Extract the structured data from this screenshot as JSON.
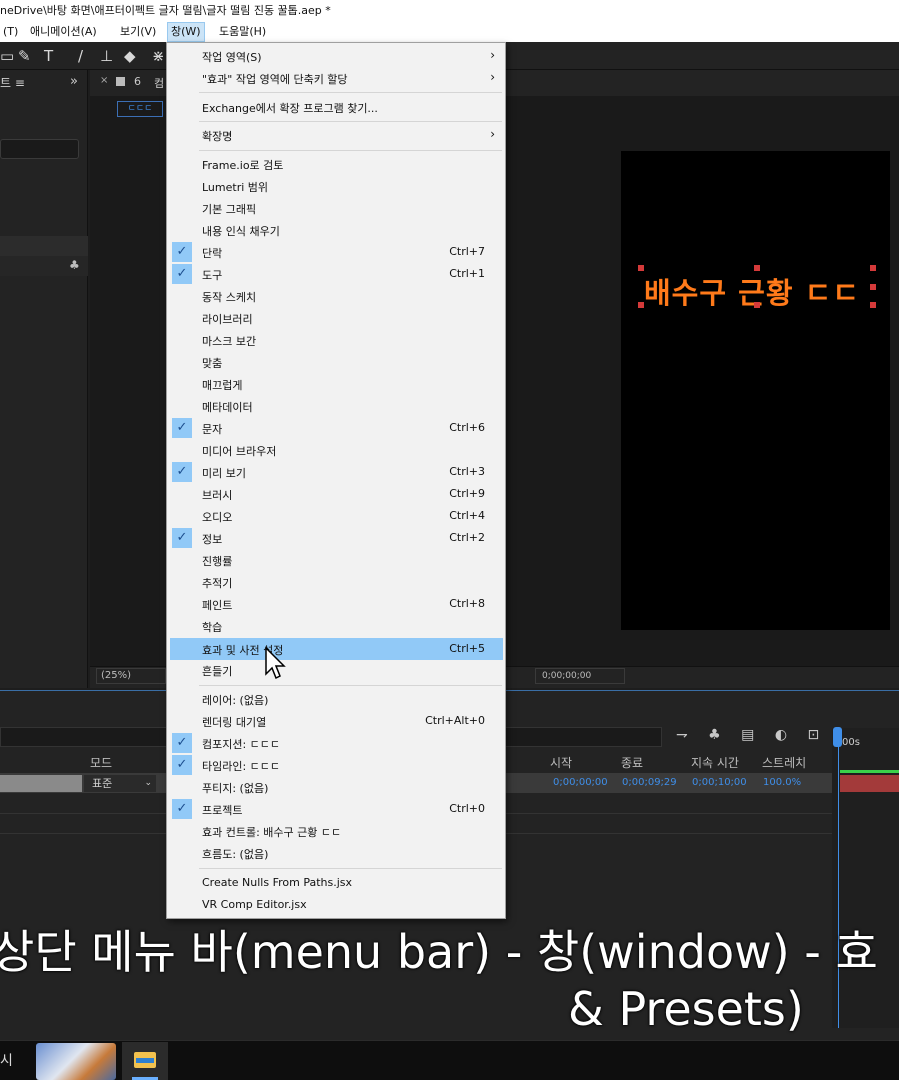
{
  "titlebar": {
    "text": "neDrive\\바탕 화면\\애프터이펙트 글자 떨림\\글자 떨림 진동 꿀톱.aep *"
  },
  "menubar": {
    "items": [
      "(T)",
      "애니메이션(A)",
      "보기(V)",
      "창(W)",
      "도움말(H)"
    ]
  },
  "left_panel": {
    "tab_label": "트 ≡",
    "expand_label": "»"
  },
  "comp_panel": {
    "tab_label": "컴",
    "subtab_label": "ㄷㄷㄷ",
    "zoom": "(25%)",
    "timecode": "0;00;00;00"
  },
  "canvas_text": "배수구 근황 ㄷㄷ",
  "timeline": {
    "columns": {
      "mode": "모드",
      "start": "시작",
      "end": "종료",
      "duration": "지속 시간",
      "stretch": "스트레치"
    },
    "row": {
      "mode_value": "표준",
      "start": "0;00;00;00",
      "end": "0;00;09;29",
      "duration": "0;00;10;00",
      "stretch": "100.0%"
    },
    "ruler_label": "00s"
  },
  "subtitle": {
    "line1": "상단 메뉴 바(menu bar) - 창(window) - 효",
    "line2": "& Presets)"
  },
  "taskbar": {
    "text": "시"
  },
  "window_menu": {
    "items": [
      {
        "label": "작업 영역(S)",
        "shortcut": "",
        "checked": false,
        "submenu": true
      },
      {
        "label": "\"효과\" 작업 영역에 단축키 할당",
        "shortcut": "",
        "checked": false,
        "submenu": true
      },
      {
        "label": "Exchange에서 확장 프로그램 찾기...",
        "shortcut": "",
        "checked": false,
        "submenu": false
      },
      {
        "label": "확장명",
        "shortcut": "",
        "checked": false,
        "submenu": true
      },
      {
        "label": "Frame.io로 검토",
        "shortcut": "",
        "checked": false,
        "submenu": false
      },
      {
        "label": "Lumetri 범위",
        "shortcut": "",
        "checked": false,
        "submenu": false
      },
      {
        "label": "기본 그래픽",
        "shortcut": "",
        "checked": false,
        "submenu": false
      },
      {
        "label": "내용 인식 채우기",
        "shortcut": "",
        "checked": false,
        "submenu": false
      },
      {
        "label": "단락",
        "shortcut": "Ctrl+7",
        "checked": true,
        "submenu": false
      },
      {
        "label": "도구",
        "shortcut": "Ctrl+1",
        "checked": true,
        "submenu": false
      },
      {
        "label": "동작 스케치",
        "shortcut": "",
        "checked": false,
        "submenu": false
      },
      {
        "label": "라이브러리",
        "shortcut": "",
        "checked": false,
        "submenu": false
      },
      {
        "label": "마스크 보간",
        "shortcut": "",
        "checked": false,
        "submenu": false
      },
      {
        "label": "맞춤",
        "shortcut": "",
        "checked": false,
        "submenu": false
      },
      {
        "label": "매끄럽게",
        "shortcut": "",
        "checked": false,
        "submenu": false
      },
      {
        "label": "메타데이터",
        "shortcut": "",
        "checked": false,
        "submenu": false
      },
      {
        "label": "문자",
        "shortcut": "Ctrl+6",
        "checked": true,
        "submenu": false
      },
      {
        "label": "미디어 브라우저",
        "shortcut": "",
        "checked": false,
        "submenu": false
      },
      {
        "label": "미리 보기",
        "shortcut": "Ctrl+3",
        "checked": true,
        "submenu": false
      },
      {
        "label": "브러시",
        "shortcut": "Ctrl+9",
        "checked": false,
        "submenu": false
      },
      {
        "label": "오디오",
        "shortcut": "Ctrl+4",
        "checked": false,
        "submenu": false
      },
      {
        "label": "정보",
        "shortcut": "Ctrl+2",
        "checked": true,
        "submenu": false
      },
      {
        "label": "진행률",
        "shortcut": "",
        "checked": false,
        "submenu": false
      },
      {
        "label": "추적기",
        "shortcut": "",
        "checked": false,
        "submenu": false
      },
      {
        "label": "페인트",
        "shortcut": "Ctrl+8",
        "checked": false,
        "submenu": false
      },
      {
        "label": "학습",
        "shortcut": "",
        "checked": false,
        "submenu": false
      },
      {
        "label": "효과 및 사전 설정",
        "shortcut": "Ctrl+5",
        "checked": false,
        "submenu": false,
        "highlighted": true
      },
      {
        "label": "흔들기",
        "shortcut": "",
        "checked": false,
        "submenu": false
      },
      {
        "label": "레이어: (없음)",
        "shortcut": "",
        "checked": false,
        "submenu": false
      },
      {
        "label": "렌더링 대기열",
        "shortcut": "Ctrl+Alt+0",
        "checked": false,
        "submenu": false
      },
      {
        "label": "컴포지션: ㄷㄷㄷ",
        "shortcut": "",
        "checked": true,
        "submenu": false
      },
      {
        "label": "타임라인: ㄷㄷㄷ",
        "shortcut": "",
        "checked": true,
        "submenu": false
      },
      {
        "label": "푸티지: (없음)",
        "shortcut": "",
        "checked": false,
        "submenu": false
      },
      {
        "label": "프로젝트",
        "shortcut": "Ctrl+0",
        "checked": true,
        "submenu": false
      },
      {
        "label": "효과 컨트롤: 배수구 근황 ㄷㄷ",
        "shortcut": "",
        "checked": false,
        "submenu": false
      },
      {
        "label": "흐름도: (없음)",
        "shortcut": "",
        "checked": false,
        "submenu": false
      },
      {
        "label": "Create Nulls From Paths.jsx",
        "shortcut": "",
        "checked": false,
        "submenu": false
      },
      {
        "label": "VR Comp Editor.jsx",
        "shortcut": "",
        "checked": false,
        "submenu": false
      }
    ]
  },
  "colors": {
    "accent_blue": "#3f8ee8",
    "menu_highlight": "#91c9f7",
    "title_orange": "#ff7a1a"
  }
}
